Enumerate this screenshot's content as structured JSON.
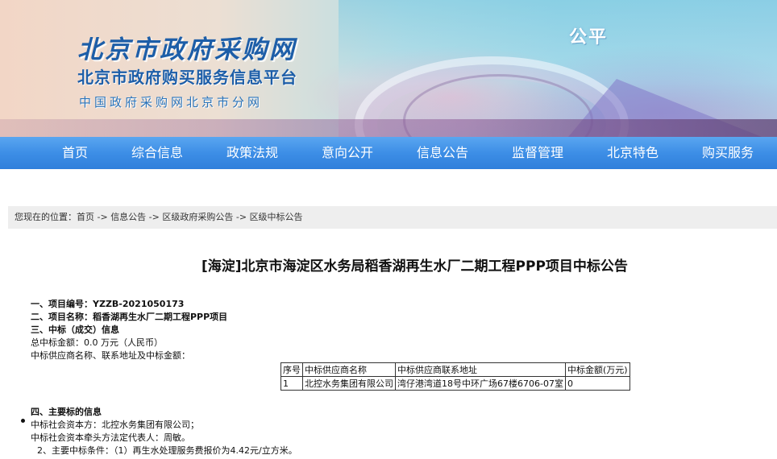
{
  "banner": {
    "title_main": "北京市政府采购网",
    "title_sub1": "北京市政府购买服务信息平台",
    "title_sub2": "中国政府采购网北京市分网",
    "slogan": "公平"
  },
  "nav": {
    "items": [
      "首页",
      "综合信息",
      "政策法规",
      "意向公开",
      "信息公告",
      "监督管理",
      "北京特色",
      "购买服务"
    ]
  },
  "breadcrumb": {
    "prefix": "您现在的位置：",
    "items": [
      "首页",
      "信息公告",
      "区级政府采购公告",
      "区级中标公告"
    ],
    "separator": " -> "
  },
  "article": {
    "title": "[海淀]北京市海淀区水务局稻香湖再生水厂二期工程PPP项目中标公告",
    "lines": {
      "project_no": "一、项目编号：YZZB-2021050173",
      "project_name": "二、项目名称：稻香湖再生水厂二期工程PPP项目",
      "award_heading": "三、中标（成交）信息",
      "total_amount": "总中标金额：0.0 万元（人民币）",
      "supplier_intro": "中标供应商名称、联系地址及中标金额："
    },
    "table": {
      "headers": [
        "序号",
        "中标供应商名称",
        "中标供应商联系地址",
        "中标金额(万元)"
      ],
      "rows": [
        [
          "1",
          "北控水务集团有限公司",
          "湾仔港湾道18号中环广场67楼6706-07室",
          "0"
        ]
      ]
    },
    "section4": {
      "heading": "四、主要标的信息",
      "capital": "中标社会资本方：北控水务集团有限公司；",
      "representative": "中标社会资本牵头方法定代表人：周敏。",
      "condition": "2、主要中标条件：（1）再生水处理服务费报价为4.42元/立方米。"
    }
  }
}
